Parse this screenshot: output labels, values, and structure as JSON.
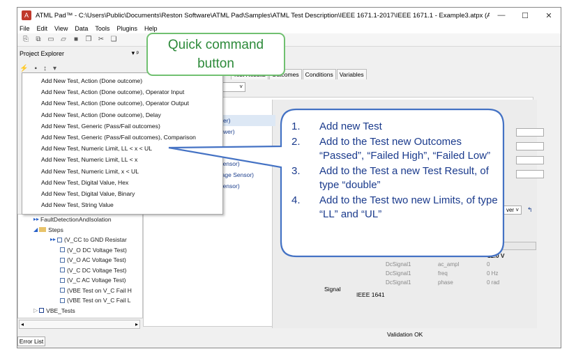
{
  "window": {
    "title": "ATML Pad™ - C:\\Users\\Public\\Documents\\Reston Software\\ATML Pad\\Samples\\ATML Test Description\\IEEE 1671.1-2017\\IEEE 1671.1 - Example3.atpx (ATML Test Descriptio...",
    "minimize": "—",
    "maximize": "☐",
    "close": "✕"
  },
  "menubar": [
    "File",
    "Edit",
    "View",
    "Data",
    "Tools",
    "Plugins",
    "Help"
  ],
  "project_explorer": {
    "title": "Project Explorer",
    "pin": "▾ ᵖ",
    "tree": [
      {
        "label": "FaultDetectionAndIsolation",
        "level": 1
      },
      {
        "label": "Steps",
        "level": 1
      },
      {
        "label": "(V_CC to GND Resistar",
        "level": 2
      },
      {
        "label": "(V_O DC Voltage Test)",
        "level": 2
      },
      {
        "label": "(V_O AC Voltage Test)",
        "level": 2
      },
      {
        "label": "(V_C DC Voltage Test)",
        "level": 2
      },
      {
        "label": "(V_C AC Voltage Test)",
        "level": 2
      },
      {
        "label": "(VBE Test on V_C Fail H",
        "level": 2
      },
      {
        "label": "(VBE Test on V_C Fail L",
        "level": 2
      },
      {
        "label": "VBE_Tests",
        "level": 0
      }
    ],
    "error_list": "Error List"
  },
  "context_menu": {
    "items": [
      "Add New Test, Action (Done outcome)",
      "Add New Test, Action (Done outcome), Operator Input",
      "Add New Test, Action (Done outcome), Operator Output",
      "Add New Test, Action (Done outcome), Delay",
      "Add New Test, Generic (Pass/Fail outcomes)",
      "Add New Test, Generic (Pass/Fail outcomes), Comparison",
      "Add New Test, Numeric Limit, LL < x < UL",
      "Add New Test, Numeric Limit, LL < x",
      "Add New Test, Numeric Limit, x < UL",
      "Add New Test, Digital Value, Hex",
      "Add New Test, Digital Value, Binary",
      "Add New Test, String Value"
    ]
  },
  "tabs": [
    "rameters",
    "Test Results",
    "Outcomes",
    "Conditions",
    "Variables"
  ],
  "left_list": [
    "C Power)",
    "DC Power)",
    "tage Sensor)",
    "C Voltage Sensor)",
    "tage Sensor)"
  ],
  "editor": {
    "dropdown": "ver ˅",
    "value_header": "ue",
    "value": "12.0 V",
    "rows": [
      {
        "signal": "DcSignal1",
        "attr": "ac_ampl",
        "val": "0"
      },
      {
        "signal": "DcSignal1",
        "attr": "freq",
        "val": "0 Hz"
      },
      {
        "signal": "DcSignal1",
        "attr": "phase",
        "val": "0 rad"
      }
    ],
    "signal_label": "Signal",
    "ieee_label": "IEEE 1641",
    "validation": "Validation OK"
  },
  "callouts": {
    "quick_command": "Quick command button",
    "steps": [
      {
        "num": "1.",
        "text": "Add new Test"
      },
      {
        "num": "2.",
        "text": "Add to the Test new Outcomes “Passed”, “Failed High”, “Failed Low”"
      },
      {
        "num": "3.",
        "text": "Add to the Test a new Test Result, of type “double”"
      },
      {
        "num": "4.",
        "text": "Add to the Test two new Limits, of type “LL” and “UL”"
      }
    ]
  },
  "colors": {
    "green_callout": "#70c070",
    "blue_callout": "#4472c4",
    "callout_text": "#1a3a8c"
  }
}
